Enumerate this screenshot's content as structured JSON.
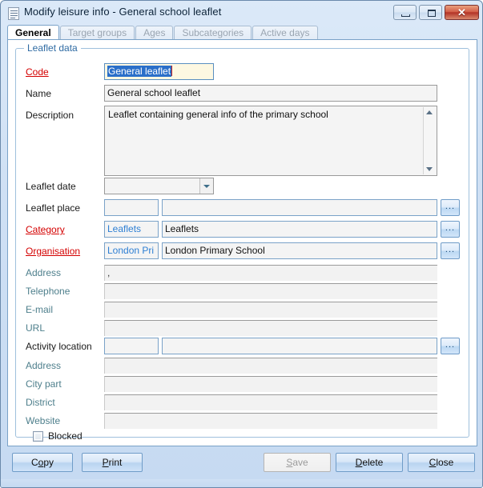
{
  "window": {
    "title": "Modify leisure info - General school leaflet",
    "icon": "document-icon",
    "buttons": {
      "minimize": "minimize-icon",
      "maximize": "maximize-icon",
      "close": "✕"
    }
  },
  "tabs": [
    {
      "label": "General",
      "active": true
    },
    {
      "label": "Target groups",
      "active": false
    },
    {
      "label": "Ages",
      "active": false
    },
    {
      "label": "Subcategories",
      "active": false
    },
    {
      "label": "Active days",
      "active": false
    }
  ],
  "group": {
    "caption": "Leaflet data"
  },
  "fields": {
    "code": {
      "label": "Code",
      "value": "General leaflet",
      "required": true,
      "focused": true
    },
    "name": {
      "label": "Name",
      "value": "General school leaflet",
      "required": false
    },
    "description": {
      "label": "Description",
      "value": "Leaflet containing general info of the primary school",
      "required": false
    },
    "leaflet_date": {
      "label": "Leaflet date",
      "value": "",
      "required": false
    },
    "leaflet_place": {
      "label": "Leaflet place",
      "code": "",
      "value": "",
      "required": false,
      "browse": "..."
    },
    "category": {
      "label": "Category",
      "code": "Leaflets",
      "value": "Leaflets",
      "required": true,
      "browse": "..."
    },
    "organisation": {
      "label": "Organisation",
      "code": "London Pri",
      "value": "London Primary School",
      "required": true,
      "browse": "..."
    },
    "org_address": {
      "label": "Address",
      "value": ",",
      "readonly": true
    },
    "org_telephone": {
      "label": "Telephone",
      "value": "",
      "readonly": true
    },
    "org_email": {
      "label": "E-mail",
      "value": "",
      "readonly": true
    },
    "org_url": {
      "label": "URL",
      "value": "",
      "readonly": true
    },
    "activity_location": {
      "label": "Activity location",
      "code": "",
      "value": "",
      "required": false,
      "browse": "..."
    },
    "loc_address": {
      "label": "Address",
      "value": "",
      "readonly": true
    },
    "loc_city_part": {
      "label": "City part",
      "value": "",
      "readonly": true
    },
    "loc_district": {
      "label": "District",
      "value": "",
      "readonly": true
    },
    "loc_website": {
      "label": "Website",
      "value": "",
      "readonly": true
    },
    "blocked": {
      "label": "Blocked",
      "checked": false
    }
  },
  "footer": {
    "copy": "Copy",
    "print": "Print",
    "save": "Save",
    "delete": "Delete",
    "close": "Close",
    "save_enabled": false
  },
  "colors": {
    "required_label": "#d40000",
    "readonly_label": "#4e7f8c",
    "code_text": "#2d7fd4",
    "focus_background": "#fdf8e2",
    "selection": "#2a6fc9",
    "field_border": "#7aa2c8"
  }
}
